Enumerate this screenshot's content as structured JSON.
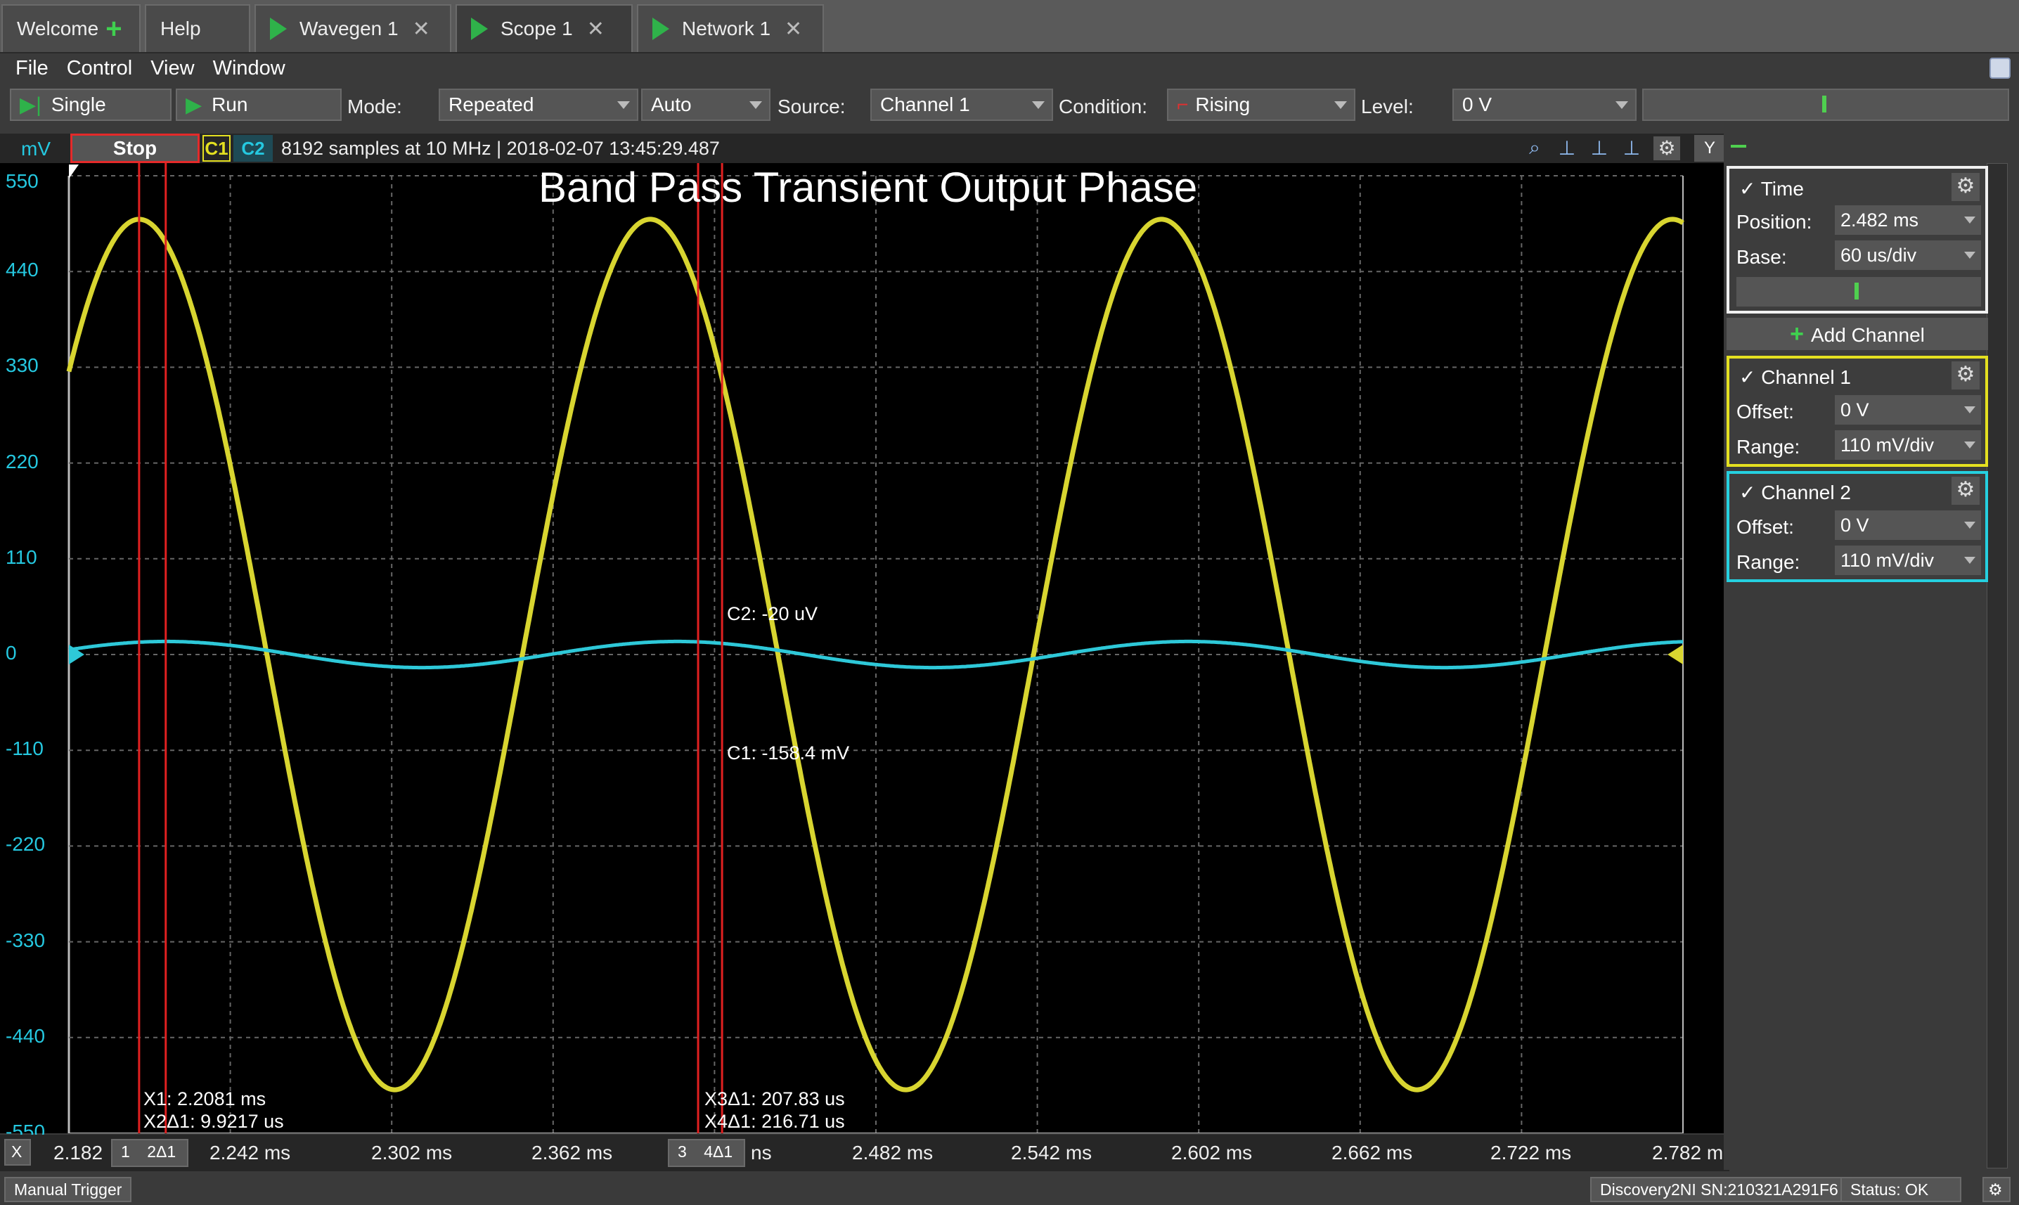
{
  "tabs": [
    {
      "label": "Welcome"
    },
    {
      "label": "Help"
    },
    {
      "label": "Wavegen 1"
    },
    {
      "label": "Scope 1"
    },
    {
      "label": "Network 1"
    }
  ],
  "menu": [
    "File",
    "Control",
    "View",
    "Window"
  ],
  "toolbar": {
    "single": "Single",
    "run": "Run",
    "mode_label": "Mode:",
    "mode_value": "Repeated",
    "auto_value": "Auto",
    "source_label": "Source:",
    "source_value": "Channel 1",
    "condition_label": "Condition:",
    "condition_value": "Rising",
    "level_label": "Level:",
    "level_value": "0 V"
  },
  "scope": {
    "unit": "mV",
    "stop": "Stop",
    "c1": "C1",
    "c2": "C2",
    "info": "8192 samples at 10 MHz | 2018-02-07 13:45:29.487",
    "title": "Band Pass Transient Output Phase",
    "y_ticks": [
      "550",
      "440",
      "330",
      "220",
      "110",
      "0",
      "-110",
      "-220",
      "-330",
      "-440",
      "-550"
    ],
    "x_ticks": [
      "2.182",
      "2.242 ms",
      "2.302 ms",
      "2.362 ms",
      "2.482 ms",
      "2.542 ms",
      "2.602 ms",
      "2.662 ms",
      "2.722 ms",
      "2.782 m"
    ],
    "x_axis_btn": "X",
    "x_cursor_btn1": "2Δ1",
    "x_cursor_btn2": "4Δ1",
    "x_cursor_n1": "1",
    "x_cursor_n2": "3",
    "x_frag": "ns",
    "cursor_c2": "C2: -20 uV",
    "cursor_c1": "C1: -158.4 mV",
    "x1": "X1: 2.2081 ms",
    "x2d1": "X2Δ1: 9.9217 us",
    "x3d1": "X3Δ1: 207.83 us",
    "x4d1": "X4Δ1: 216.71 us"
  },
  "panel": {
    "time_title": "Time",
    "position_label": "Position:",
    "position_value": "2.482 ms",
    "base_label": "Base:",
    "base_value": "60 us/div",
    "add_channel": "Add Channel",
    "ch1_title": "Channel 1",
    "ch1_offset_label": "Offset:",
    "ch1_offset_value": "0 V",
    "ch1_range_label": "Range:",
    "ch1_range_value": "110 mV/div",
    "ch2_title": "Channel 2",
    "ch2_offset_label": "Offset:",
    "ch2_offset_value": "0 V",
    "ch2_range_label": "Range:",
    "ch2_range_value": "110 mV/div"
  },
  "status": {
    "manual_trigger": "Manual Trigger",
    "device": "Discovery2NI SN:210321A291F6",
    "status": "Status: OK"
  },
  "signals": {
    "c1_amplitude_mv": 500,
    "c2_amplitude_mv": 15,
    "period_us": 190,
    "c1_color": "#d8d530",
    "c2_color": "#2ec8d8",
    "cursor_color": "#e02020"
  }
}
